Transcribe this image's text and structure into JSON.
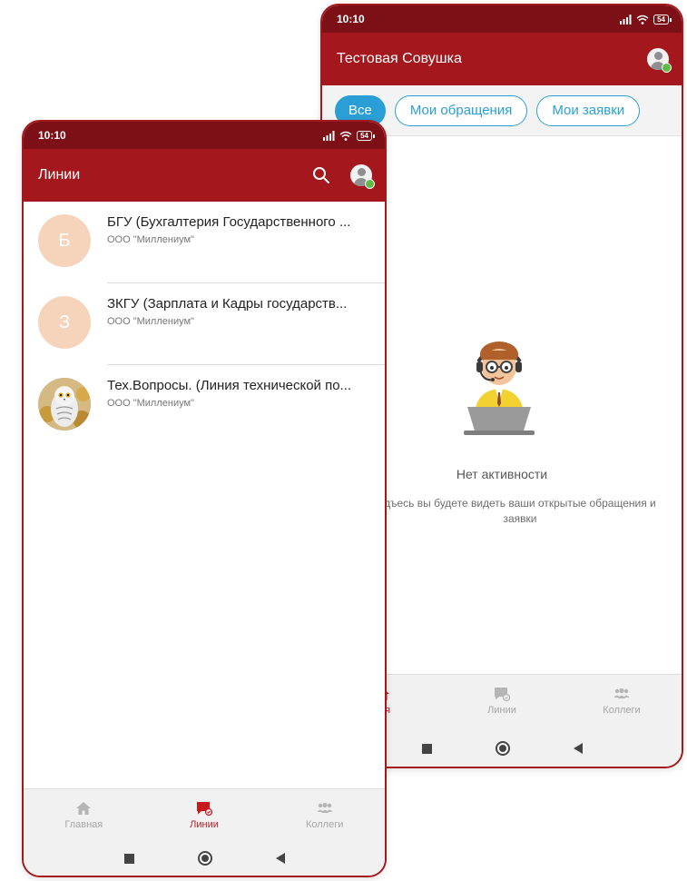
{
  "back_phone": {
    "status": {
      "time": "10:10",
      "battery": "54"
    },
    "title": "Тестовая Совушка",
    "filters": [
      {
        "label": "Все",
        "active": true
      },
      {
        "label": "Мои обращения",
        "active": false
      },
      {
        "label": "Мои заявки",
        "active": false
      }
    ],
    "empty_state": {
      "title": "Нет активности",
      "subtitle": "дъесь вы будете видеть ваши открытые обращения и заявки"
    },
    "bottom_nav": [
      {
        "label": "ная",
        "icon": "home-icon",
        "active": true
      },
      {
        "label": "Линии",
        "icon": "chat-icon",
        "active": false
      },
      {
        "label": "Коллеги",
        "icon": "people-icon",
        "active": false
      }
    ]
  },
  "front_phone": {
    "status": {
      "time": "10:10",
      "battery": "54"
    },
    "title": "Линии",
    "lines": [
      {
        "initial": "Б",
        "title": "БГУ (Бухгалтерия Государственного ...",
        "subtitle": "ООО \"Миллениум\""
      },
      {
        "initial": "З",
        "title": "ЗКГУ (Зарплата и Кадры государств...",
        "subtitle": "ООО \"Миллениум\""
      },
      {
        "initial": "",
        "title": "Тех.Вопросы. (Линия технической по...",
        "subtitle": "ООО \"Миллениум\""
      }
    ],
    "bottom_nav": [
      {
        "label": "Главная",
        "icon": "home-icon",
        "active": false
      },
      {
        "label": "Линии",
        "icon": "chat-icon",
        "active": true
      },
      {
        "label": "Коллеги",
        "icon": "people-icon",
        "active": false
      }
    ]
  },
  "colors": {
    "status_bar": "#7c1016",
    "app_bar": "#a3171d",
    "accent_blue": "#2a9fd6",
    "active_nav": "#c8191f",
    "online": "#5fbb46"
  }
}
